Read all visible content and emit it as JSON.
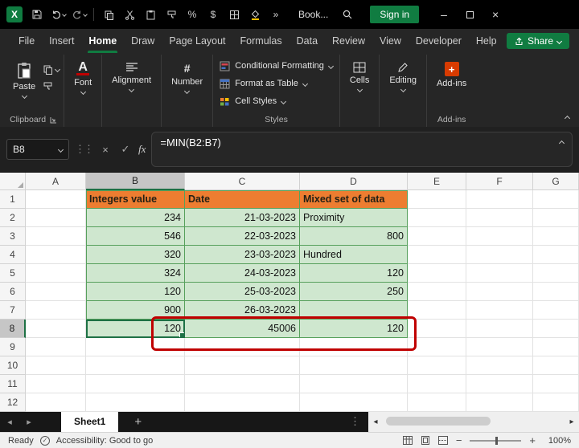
{
  "titlebar": {
    "doc_name": "Book...",
    "sign_in_label": "Sign in"
  },
  "menubar": {
    "tabs": [
      "File",
      "Insert",
      "Home",
      "Draw",
      "Page Layout",
      "Formulas",
      "Data",
      "Review",
      "View",
      "Developer",
      "Help"
    ],
    "active_tab": "Home",
    "share_label": "Share"
  },
  "ribbon": {
    "paste_label": "Paste",
    "clipboard_group_label": "Clipboard",
    "font_label": "Font",
    "alignment_label": "Alignment",
    "number_label": "Number",
    "styles_buttons": [
      "Conditional Formatting",
      "Format as Table",
      "Cell Styles"
    ],
    "styles_group_label": "Styles",
    "cells_label": "Cells",
    "editing_label": "Editing",
    "addins_label": "Add-ins",
    "addins_group_label": "Add-ins"
  },
  "formula_bar": {
    "name_box_value": "B8",
    "fx_label": "fx",
    "formula": "=MIN(B2:B7)"
  },
  "grid": {
    "column_headers": [
      "A",
      "B",
      "C",
      "D",
      "E",
      "F",
      "G"
    ],
    "row_headers": [
      "1",
      "2",
      "3",
      "4",
      "5",
      "6",
      "7",
      "8",
      "9",
      "10",
      "11",
      "12"
    ],
    "selected_cell": "B8",
    "selected_column": "B",
    "selected_row": "8",
    "green_range": "B1:D8",
    "orange_cells": [
      "B1",
      "C1",
      "D1"
    ],
    "cells": {
      "B1": "Integers value",
      "C1": "Date",
      "D1": "Mixed set of data",
      "B2": "234",
      "C2": "21-03-2023",
      "D2": "Proximity",
      "B3": "546",
      "C3": "22-03-2023",
      "D3": "800",
      "B4": "320",
      "C4": "23-03-2023",
      "D4": "Hundred",
      "B5": "324",
      "C5": "24-03-2023",
      "D5": "120",
      "B6": "120",
      "C6": "25-03-2023",
      "D6": "250",
      "B7": "900",
      "C7": "26-03-2023",
      "B8": "120",
      "C8": "45006",
      "D8": "120"
    }
  },
  "sheet_tabs": {
    "active_tab": "Sheet1",
    "add_label": "+"
  },
  "status_bar": {
    "ready_label": "Ready",
    "accessibility_label": "Accessibility: Good to go",
    "zoom_level": "100%"
  },
  "colors": {
    "excel_green": "#107c41",
    "header_orange": "#ed7d31",
    "cell_green": "#cfe7cf",
    "grid_green_border": "#57a05c",
    "selection_green": "#1e7145",
    "annotation_red": "#c00000"
  }
}
